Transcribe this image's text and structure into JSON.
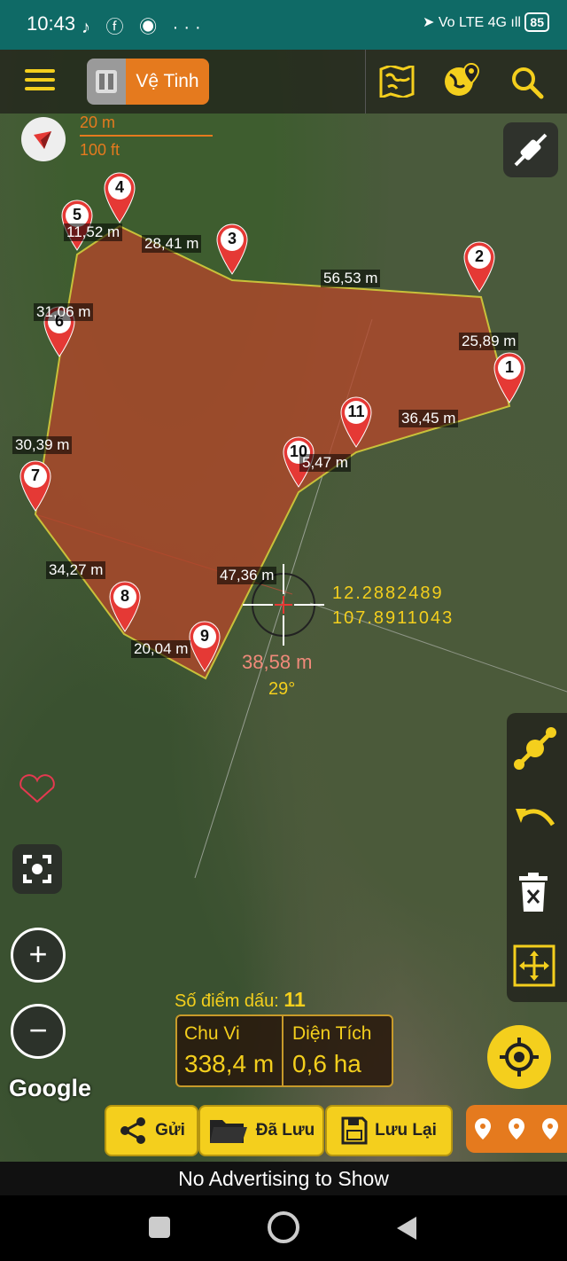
{
  "status": {
    "time": "10:43",
    "left_icons": "♪ ⓕ ◉ ···",
    "right_icons": "➤ Vo LTE 4G ıll",
    "battery": "85"
  },
  "toolbar": {
    "map_type_label": "Vệ Tinh"
  },
  "scale": {
    "metric": "20 m",
    "imperial": "100 ft"
  },
  "markers": [
    "1",
    "2",
    "3",
    "4",
    "5",
    "6",
    "7",
    "8",
    "9",
    "10",
    "11"
  ],
  "distances": [
    "25,89 m",
    "56,53 m",
    "28,41 m",
    "11,52 m",
    "31,06 m",
    "30,39 m",
    "34,27 m",
    "20,04 m",
    "47,36 m",
    "5,47 m",
    "36,45 m"
  ],
  "crosshair": {
    "lat": "12.2882489",
    "lng": "107.8911043",
    "distance": "38,58 m",
    "angle": "29°"
  },
  "stats": {
    "points_label": "Số điểm dấu:",
    "points_value": "11",
    "perimeter_label": "Chu Vi",
    "perimeter_value": "338,4 m",
    "area_label": "Diện Tích",
    "area_value": "0,6 ha"
  },
  "google": "Google",
  "buttons": {
    "send": "Gửi",
    "saved": "Đã Lưu",
    "save": "Lưu Lại"
  },
  "ad_text": "No Advertising to Show",
  "colors": {
    "accent": "#f4cf1d",
    "polygon": "#b4462a",
    "marker": "#e53935",
    "teal": "#0f6a66",
    "orange": "#e57a1e"
  }
}
